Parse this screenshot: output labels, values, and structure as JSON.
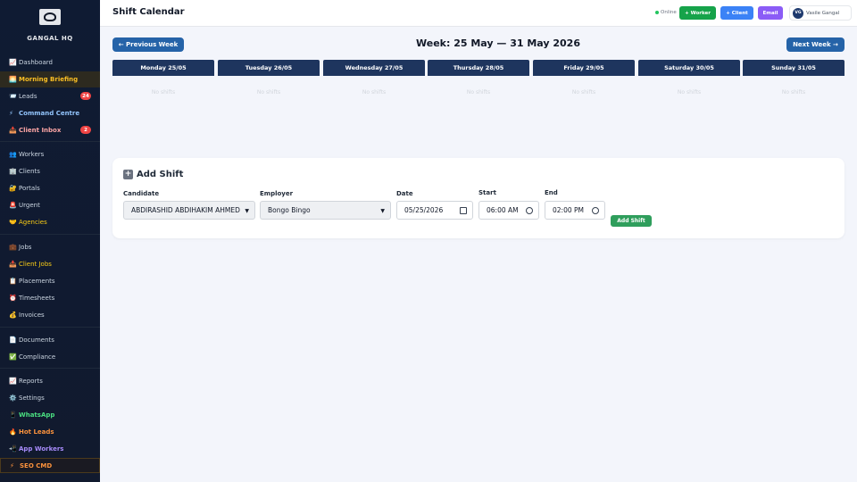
{
  "sidebar": {
    "brand": "GANGAL HQ",
    "items": [
      {
        "icon": "📈",
        "label": "Dashboard"
      },
      {
        "icon": "🌅",
        "label": "Morning Briefing"
      },
      {
        "icon": "📨",
        "label": "Leads",
        "badge": "24"
      },
      {
        "icon": "⚡",
        "label": "Command Centre"
      },
      {
        "icon": "📥",
        "label": "Client Inbox",
        "badge": "2"
      },
      {
        "icon": "👥",
        "label": "Workers"
      },
      {
        "icon": "🏢",
        "label": "Clients"
      },
      {
        "icon": "🔐",
        "label": "Portals"
      },
      {
        "icon": "🚨",
        "label": "Urgent"
      },
      {
        "icon": "🤝",
        "label": "Agencies"
      },
      {
        "icon": "💼",
        "label": "Jobs"
      },
      {
        "icon": "📥",
        "label": "Client Jobs"
      },
      {
        "icon": "📋",
        "label": "Placements"
      },
      {
        "icon": "⏰",
        "label": "Timesheets"
      },
      {
        "icon": "💰",
        "label": "Invoices"
      },
      {
        "icon": "📄",
        "label": "Documents"
      },
      {
        "icon": "✅",
        "label": "Compliance"
      },
      {
        "icon": "📈",
        "label": "Reports"
      },
      {
        "icon": "⚙️",
        "label": "Settings"
      },
      {
        "icon": "📱",
        "label": "WhatsApp"
      },
      {
        "icon": "🔥",
        "label": "Hot Leads"
      },
      {
        "icon": "📲",
        "label": "App Workers"
      },
      {
        "icon": "⚡",
        "label": "SEO CMD"
      }
    ]
  },
  "header": {
    "title": "Shift Calendar",
    "status": "Online",
    "buttons": {
      "worker": "+ Worker",
      "client": "+ Client",
      "email": "Email"
    },
    "user": {
      "initials": "VG",
      "name": "Vasile Gangal"
    }
  },
  "week": {
    "prev_label": "← Previous Week",
    "next_label": "Next Week →",
    "title": "Week: 25 May — 31 May 2026",
    "days": [
      {
        "label": "Monday 25/05",
        "empty": "No shifts"
      },
      {
        "label": "Tuesday 26/05",
        "empty": "No shifts"
      },
      {
        "label": "Wednesday 27/05",
        "empty": "No shifts"
      },
      {
        "label": "Thursday 28/05",
        "empty": "No shifts"
      },
      {
        "label": "Friday 29/05",
        "empty": "No shifts"
      },
      {
        "label": "Saturday 30/05",
        "empty": "No shifts"
      },
      {
        "label": "Sunday 31/05",
        "empty": "No shifts"
      }
    ]
  },
  "add_shift": {
    "title": "Add Shift",
    "candidate_label": "Candidate",
    "candidate_value": "ABDIRASHID ABDIHAKIM AHMED",
    "employer_label": "Employer",
    "employer_value": "Bongo Bingo",
    "date_label": "Date",
    "date_value": "05/25/2026",
    "start_label": "Start",
    "start_value": "06:00 AM",
    "end_label": "End",
    "end_value": "02:00 PM",
    "submit_label": "Add Shift"
  },
  "colors": {
    "sidebar_bg": "#0f1b33",
    "day_header": "#1e355e",
    "primary_button": "#2563a8",
    "worker_button": "#16a34a",
    "client_button": "#3b82f6",
    "email_button": "#8b5cf6",
    "add_button": "#2f9e5c"
  }
}
